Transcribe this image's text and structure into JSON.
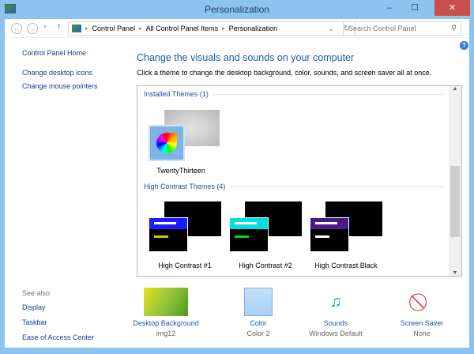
{
  "window": {
    "title": "Personalization",
    "minimize": "–",
    "maximize": "☐",
    "close": "✕"
  },
  "address": {
    "back": "←",
    "forward": "→",
    "up": "↑",
    "crumbs": [
      "Control Panel",
      "All Control Panel Items",
      "Personalization"
    ],
    "search_placeholder": "Search Control Panel",
    "refresh": "↻",
    "dropdown": "⌄",
    "search_icon": "⚲"
  },
  "sidebar": {
    "home": "Control Panel Home",
    "links": [
      "Change desktop icons",
      "Change mouse pointers"
    ],
    "see_also": "See also",
    "see_also_links": [
      "Display",
      "Taskbar",
      "Ease of Access Center"
    ]
  },
  "main": {
    "heading": "Change the visuals and sounds on your computer",
    "subtitle": "Click a theme to change the desktop background, color, sounds, and screen saver all at once.",
    "help": "?",
    "installed_group": "Installed Themes (1)",
    "installed": [
      {
        "name": "TwentyThirteen"
      }
    ],
    "hc_group": "High Contrast Themes (4)",
    "hc": [
      {
        "name": "High Contrast #1",
        "accent": "#1b1bff",
        "bar2": "#c8c800"
      },
      {
        "name": "High Contrast #2",
        "accent": "#00e0e0",
        "bar2": "#00e000"
      },
      {
        "name": "High Contrast Black",
        "accent": "#4a1a8a",
        "bar2": "#ffffff"
      }
    ]
  },
  "bottom": [
    {
      "label": "Desktop Background",
      "value": "img12"
    },
    {
      "label": "Color",
      "value": "Color 2"
    },
    {
      "label": "Sounds",
      "value": "Windows Default"
    },
    {
      "label": "Screen Saver",
      "value": "None"
    }
  ]
}
